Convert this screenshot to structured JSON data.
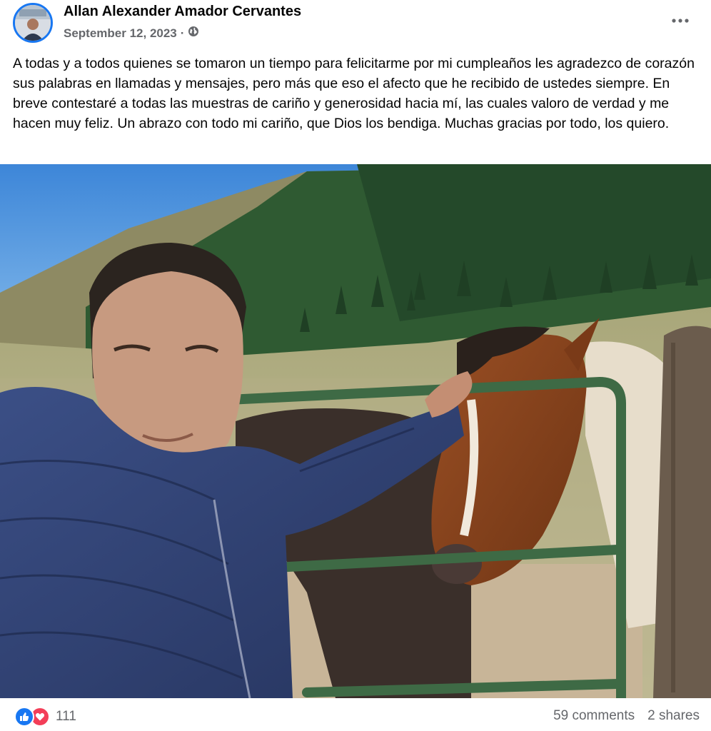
{
  "post": {
    "author": "Allan Alexander Amador Cervantes",
    "date": "September 12, 2023",
    "separator": "·",
    "privacy_icon": "globe-icon",
    "more_icon": "more-options-icon",
    "text": "A todas y a todos quienes se tomaron un tiempo para felicitarme por mi cumpleaños les agradezco de corazón sus palabras en llamadas y mensajes, pero más que eso el afecto que he recibido de ustedes siempre. En breve contestaré a todas las muestras de cariño y generosidad hacia mí, las cuales valoro de verdad y me hacen muy feliz. Un abrazo con todo mi cariño, que Dios los bendiga. Muchas gracias por todo, los quiero."
  },
  "footer": {
    "reaction_icons": [
      "like-icon",
      "love-icon"
    ],
    "reaction_count": "111",
    "comments": "59 comments",
    "shares": "2 shares"
  },
  "colors": {
    "accent": "#1877f2",
    "love": "#f33e58",
    "secondary_text": "#65676b"
  }
}
